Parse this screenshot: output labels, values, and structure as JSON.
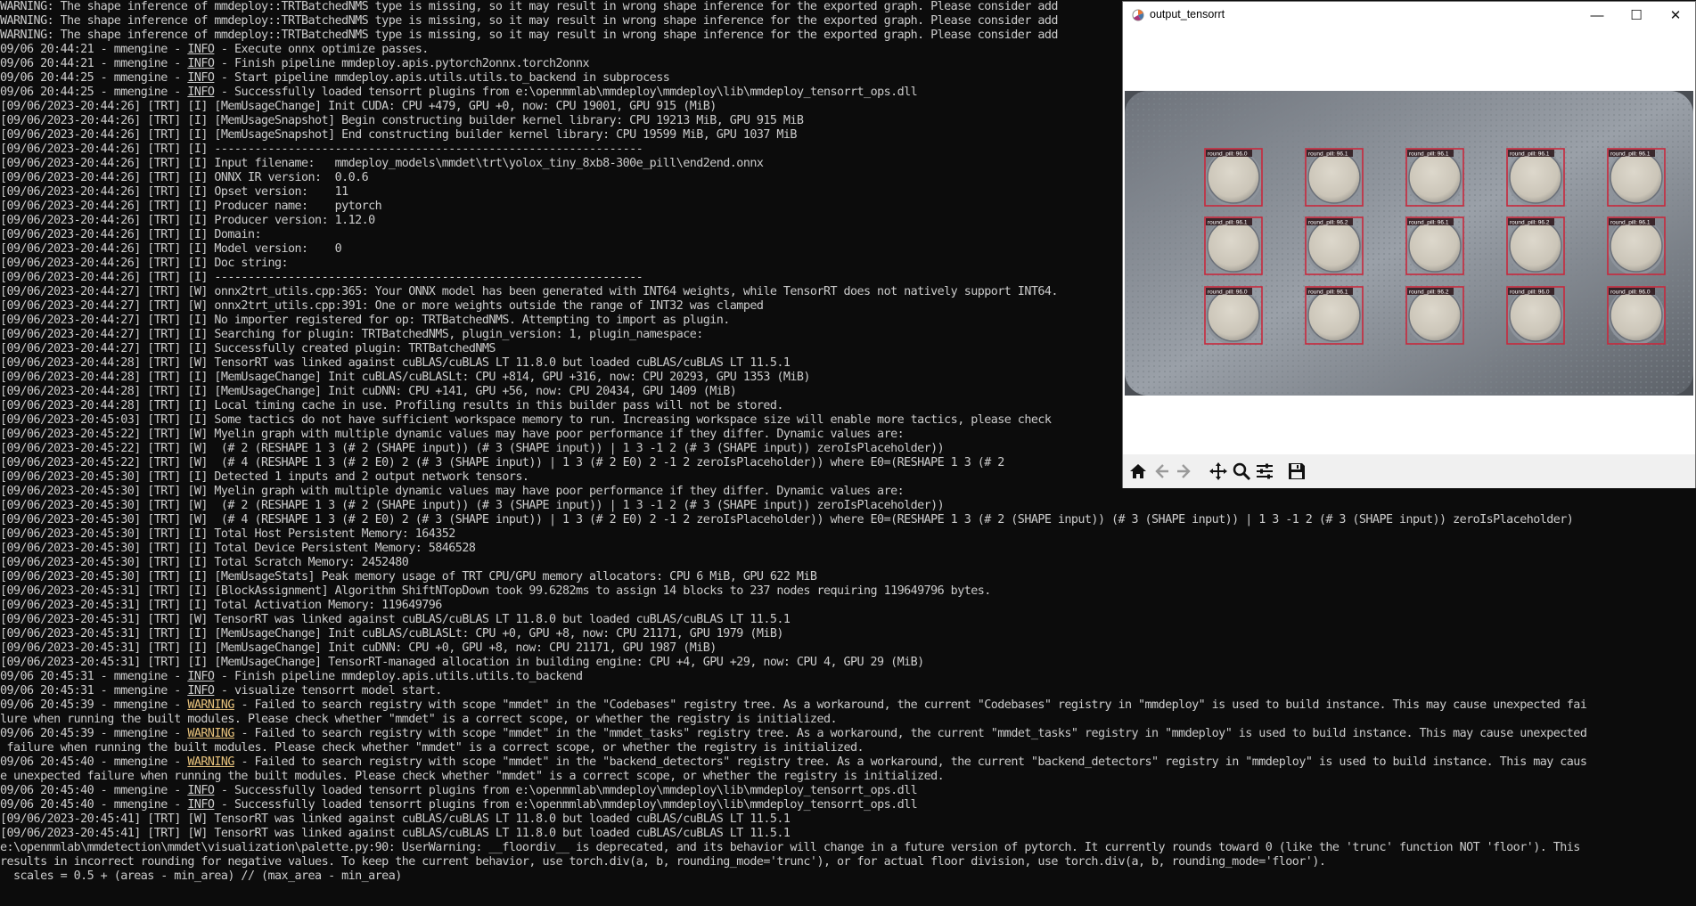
{
  "console": {
    "lines": [
      [
        {
          "t": "WARNING: The shape inference of mmdeploy::TRTBatchedNMS type is missing, so it may result in wrong shape inference for the exported graph. Please consider add"
        }
      ],
      [
        {
          "t": "WARNING: The shape inference of mmdeploy::TRTBatchedNMS type is missing, so it may result in wrong shape inference for the exported graph. Please consider add"
        }
      ],
      [
        {
          "t": "WARNING: The shape inference of mmdeploy::TRTBatchedNMS type is missing, so it may result in wrong shape inference for the exported graph. Please consider add"
        }
      ],
      [
        {
          "t": "09/06 20:44:21 - mmengine - "
        },
        {
          "t": "INFO",
          "c": "info"
        },
        {
          "t": " - Execute onnx optimize passes."
        }
      ],
      [
        {
          "t": "09/06 20:44:21 - mmengine - "
        },
        {
          "t": "INFO",
          "c": "info"
        },
        {
          "t": " - Finish pipeline mmdeploy.apis.pytorch2onnx.torch2onnx"
        }
      ],
      [
        {
          "t": "09/06 20:44:25 - mmengine - "
        },
        {
          "t": "INFO",
          "c": "info"
        },
        {
          "t": " - Start pipeline mmdeploy.apis.utils.utils.to_backend in subprocess"
        }
      ],
      [
        {
          "t": "09/06 20:44:25 - mmengine - "
        },
        {
          "t": "INFO",
          "c": "info"
        },
        {
          "t": " - Successfully loaded tensorrt plugins from e:\\openmmlab\\mmdeploy\\mmdeploy\\lib\\mmdeploy_tensorrt_ops.dll"
        }
      ],
      [
        {
          "t": "[09/06/2023-20:44:26] [TRT] [I] [MemUsageChange] Init CUDA: CPU +479, GPU +0, now: CPU 19001, GPU 915 (MiB)"
        }
      ],
      [
        {
          "t": "[09/06/2023-20:44:26] [TRT] [I] [MemUsageSnapshot] Begin constructing builder kernel library: CPU 19213 MiB, GPU 915 MiB"
        }
      ],
      [
        {
          "t": "[09/06/2023-20:44:26] [TRT] [I] [MemUsageSnapshot] End constructing builder kernel library: CPU 19599 MiB, GPU 1037 MiB"
        }
      ],
      [
        {
          "t": "[09/06/2023-20:44:26] [TRT] [I] ----------------------------------------------------------------"
        }
      ],
      [
        {
          "t": "[09/06/2023-20:44:26] [TRT] [I] Input filename:   mmdeploy_models\\mmdet\\trt\\yolox_tiny_8xb8-300e_pill\\end2end.onnx"
        }
      ],
      [
        {
          "t": "[09/06/2023-20:44:26] [TRT] [I] ONNX IR version:  0.0.6"
        }
      ],
      [
        {
          "t": "[09/06/2023-20:44:26] [TRT] [I] Opset version:    11"
        }
      ],
      [
        {
          "t": "[09/06/2023-20:44:26] [TRT] [I] Producer name:    pytorch"
        }
      ],
      [
        {
          "t": "[09/06/2023-20:44:26] [TRT] [I] Producer version: 1.12.0"
        }
      ],
      [
        {
          "t": "[09/06/2023-20:44:26] [TRT] [I] Domain:"
        }
      ],
      [
        {
          "t": "[09/06/2023-20:44:26] [TRT] [I] Model version:    0"
        }
      ],
      [
        {
          "t": "[09/06/2023-20:44:26] [TRT] [I] Doc string:"
        }
      ],
      [
        {
          "t": "[09/06/2023-20:44:26] [TRT] [I] ----------------------------------------------------------------"
        }
      ],
      [
        {
          "t": "[09/06/2023-20:44:27] [TRT] [W] onnx2trt_utils.cpp:365: Your ONNX model has been generated with INT64 weights, while TensorRT does not natively support INT64."
        }
      ],
      [
        {
          "t": "[09/06/2023-20:44:27] [TRT] [W] onnx2trt_utils.cpp:391: One or more weights outside the range of INT32 was clamped"
        }
      ],
      [
        {
          "t": "[09/06/2023-20:44:27] [TRT] [I] No importer registered for op: TRTBatchedNMS. Attempting to import as plugin."
        }
      ],
      [
        {
          "t": "[09/06/2023-20:44:27] [TRT] [I] Searching for plugin: TRTBatchedNMS, plugin_version: 1, plugin_namespace:"
        }
      ],
      [
        {
          "t": "[09/06/2023-20:44:27] [TRT] [I] Successfully created plugin: TRTBatchedNMS"
        }
      ],
      [
        {
          "t": "[09/06/2023-20:44:28] [TRT] [W] TensorRT was linked against cuBLAS/cuBLAS LT 11.8.0 but loaded cuBLAS/cuBLAS LT 11.5.1"
        }
      ],
      [
        {
          "t": "[09/06/2023-20:44:28] [TRT] [I] [MemUsageChange] Init cuBLAS/cuBLASLt: CPU +814, GPU +316, now: CPU 20293, GPU 1353 (MiB)"
        }
      ],
      [
        {
          "t": "[09/06/2023-20:44:28] [TRT] [I] [MemUsageChange] Init cuDNN: CPU +141, GPU +56, now: CPU 20434, GPU 1409 (MiB)"
        }
      ],
      [
        {
          "t": "[09/06/2023-20:44:28] [TRT] [I] Local timing cache in use. Profiling results in this builder pass will not be stored."
        }
      ],
      [
        {
          "t": "[09/06/2023-20:45:03] [TRT] [I] Some tactics do not have sufficient workspace memory to run. Increasing workspace size will enable more tactics, please check"
        }
      ],
      [
        {
          "t": "[09/06/2023-20:45:22] [TRT] [W] Myelin graph with multiple dynamic values may have poor performance if they differ. Dynamic values are:"
        }
      ],
      [
        {
          "t": "[09/06/2023-20:45:22] [TRT] [W]  (# 2 (RESHAPE 1 3 (# 2 (SHAPE input)) (# 3 (SHAPE input)) | 1 3 -1 2 (# 3 (SHAPE input)) zeroIsPlaceholder))"
        }
      ],
      [
        {
          "t": "[09/06/2023-20:45:22] [TRT] [W]  (# 4 (RESHAPE 1 3 (# 2 E0) 2 (# 3 (SHAPE input)) | 1 3 (# 2 E0) 2 -1 2 zeroIsPlaceholder)) where E0=(RESHAPE 1 3 (# 2"
        }
      ],
      [
        {
          "t": "[09/06/2023-20:45:30] [TRT] [I] Detected 1 inputs and 2 output network tensors."
        }
      ],
      [
        {
          "t": "[09/06/2023-20:45:30] [TRT] [W] Myelin graph with multiple dynamic values may have poor performance if they differ. Dynamic values are:"
        }
      ],
      [
        {
          "t": "[09/06/2023-20:45:30] [TRT] [W]  (# 2 (RESHAPE 1 3 (# 2 (SHAPE input)) (# 3 (SHAPE input)) | 1 3 -1 2 (# 3 (SHAPE input)) zeroIsPlaceholder))"
        }
      ],
      [
        {
          "t": "[09/06/2023-20:45:30] [TRT] [W]  (# 4 (RESHAPE 1 3 (# 2 E0) 2 (# 3 (SHAPE input)) | 1 3 (# 2 E0) 2 -1 2 zeroIsPlaceholder)) where E0=(RESHAPE 1 3 (# 2 (SHAPE input)) (# 3 (SHAPE input)) | 1 3 -1 2 (# 3 (SHAPE input)) zeroIsPlaceholder)"
        }
      ],
      [
        {
          "t": "[09/06/2023-20:45:30] [TRT] [I] Total Host Persistent Memory: 164352"
        }
      ],
      [
        {
          "t": "[09/06/2023-20:45:30] [TRT] [I] Total Device Persistent Memory: 5846528"
        }
      ],
      [
        {
          "t": "[09/06/2023-20:45:30] [TRT] [I] Total Scratch Memory: 2452480"
        }
      ],
      [
        {
          "t": "[09/06/2023-20:45:30] [TRT] [I] [MemUsageStats] Peak memory usage of TRT CPU/GPU memory allocators: CPU 6 MiB, GPU 622 MiB"
        }
      ],
      [
        {
          "t": "[09/06/2023-20:45:31] [TRT] [I] [BlockAssignment] Algorithm ShiftNTopDown took 99.6282ms to assign 14 blocks to 237 nodes requiring 119649796 bytes."
        }
      ],
      [
        {
          "t": "[09/06/2023-20:45:31] [TRT] [I] Total Activation Memory: 119649796"
        }
      ],
      [
        {
          "t": "[09/06/2023-20:45:31] [TRT] [W] TensorRT was linked against cuBLAS/cuBLAS LT 11.8.0 but loaded cuBLAS/cuBLAS LT 11.5.1"
        }
      ],
      [
        {
          "t": "[09/06/2023-20:45:31] [TRT] [I] [MemUsageChange] Init cuBLAS/cuBLASLt: CPU +0, GPU +8, now: CPU 21171, GPU 1979 (MiB)"
        }
      ],
      [
        {
          "t": "[09/06/2023-20:45:31] [TRT] [I] [MemUsageChange] Init cuDNN: CPU +0, GPU +8, now: CPU 21171, GPU 1987 (MiB)"
        }
      ],
      [
        {
          "t": "[09/06/2023-20:45:31] [TRT] [I] [MemUsageChange] TensorRT-managed allocation in building engine: CPU +4, GPU +29, now: CPU 4, GPU 29 (MiB)"
        }
      ],
      [
        {
          "t": "09/06 20:45:31 - mmengine - "
        },
        {
          "t": "INFO",
          "c": "info"
        },
        {
          "t": " - Finish pipeline mmdeploy.apis.utils.utils.to_backend"
        }
      ],
      [
        {
          "t": "09/06 20:45:31 - mmengine - "
        },
        {
          "t": "INFO",
          "c": "info"
        },
        {
          "t": " - visualize tensorrt model start."
        }
      ],
      [
        {
          "t": "09/06 20:45:39 - mmengine - "
        },
        {
          "t": "WARNING",
          "c": "warn"
        },
        {
          "t": " - Failed to search registry with scope \"mmdet\" in the \"Codebases\" registry tree. As a workaround, the current \"Codebases\" registry in \"mmdeploy\" is used to build instance. This may cause unexpected fai"
        }
      ],
      [
        {
          "t": "lure when running the built modules. Please check whether \"mmdet\" is a correct scope, or whether the registry is initialized."
        }
      ],
      [
        {
          "t": "09/06 20:45:39 - mmengine - "
        },
        {
          "t": "WARNING",
          "c": "warn"
        },
        {
          "t": " - Failed to search registry with scope \"mmdet\" in the \"mmdet_tasks\" registry tree. As a workaround, the current \"mmdet_tasks\" registry in \"mmdeploy\" is used to build instance. This may cause unexpected"
        }
      ],
      [
        {
          "t": " failure when running the built modules. Please check whether \"mmdet\" is a correct scope, or whether the registry is initialized."
        }
      ],
      [
        {
          "t": "09/06 20:45:40 - mmengine - "
        },
        {
          "t": "WARNING",
          "c": "warn"
        },
        {
          "t": " - Failed to search registry with scope \"mmdet\" in the \"backend_detectors\" registry tree. As a workaround, the current \"backend_detectors\" registry in \"mmdeploy\" is used to build instance. This may caus"
        }
      ],
      [
        {
          "t": "e unexpected failure when running the built modules. Please check whether \"mmdet\" is a correct scope, or whether the registry is initialized."
        }
      ],
      [
        {
          "t": "09/06 20:45:40 - mmengine - "
        },
        {
          "t": "INFO",
          "c": "info"
        },
        {
          "t": " - Successfully loaded tensorrt plugins from e:\\openmmlab\\mmdeploy\\mmdeploy\\lib\\mmdeploy_tensorrt_ops.dll"
        }
      ],
      [
        {
          "t": "09/06 20:45:40 - mmengine - "
        },
        {
          "t": "INFO",
          "c": "info"
        },
        {
          "t": " - Successfully loaded tensorrt plugins from e:\\openmmlab\\mmdeploy\\mmdeploy\\lib\\mmdeploy_tensorrt_ops.dll"
        }
      ],
      [
        {
          "t": "[09/06/2023-20:45:41] [TRT] [W] TensorRT was linked against cuBLAS/cuBLAS LT 11.8.0 but loaded cuBLAS/cuBLAS LT 11.5.1"
        }
      ],
      [
        {
          "t": "[09/06/2023-20:45:41] [TRT] [W] TensorRT was linked against cuBLAS/cuBLAS LT 11.8.0 but loaded cuBLAS/cuBLAS LT 11.5.1"
        }
      ],
      [
        {
          "t": "e:\\openmmlab\\mmdetection\\mmdet\\visualization\\palette.py:90: UserWarning: __floordiv__ is deprecated, and its behavior will change in a future version of pytorch. It currently rounds toward 0 (like the 'trunc' function NOT 'floor'). This"
        }
      ],
      [
        {
          "t": "results in incorrect rounding for negative values. To keep the current behavior, use torch.div(a, b, rounding_mode='trunc'), or for actual floor division, use torch.div(a, b, rounding_mode='floor')."
        }
      ],
      [
        {
          "t": "  scales = 0.5 + (areas - min_area) // (max_area - min_area)"
        }
      ]
    ]
  },
  "window": {
    "title": "output_tensorrt",
    "minimize_glyph": "—",
    "maximize_glyph": "☐",
    "close_glyph": "✕"
  },
  "detections": {
    "rows": [
      [
        "round_pill: 96.0",
        "round_pill: 96.1",
        "round_pill: 96.1",
        "round_pill: 96.1",
        "round_pill: 96.1"
      ],
      [
        "round_pill: 96.1",
        "round_pill: 96.2",
        "round_pill: 96.1",
        "round_pill: 96.2",
        "round_pill: 96.1"
      ],
      [
        "round_pill: 96.0",
        "round_pill: 96.1",
        "round_pill: 96.2",
        "round_pill: 96.0",
        "round_pill: 96.0"
      ]
    ],
    "box_color": "#c8283c",
    "label_bg": "#2a1418",
    "label_color": "#ffffff"
  },
  "toolbar": {
    "icons": [
      "home-icon",
      "back-arrow-icon",
      "forward-arrow-icon",
      "pan-move-icon",
      "zoom-magnifier-icon",
      "configure-subplots-icon",
      "save-floppy-icon"
    ]
  },
  "colors": {
    "console_bg": "#0c0c0c",
    "console_fg": "#cccccc",
    "warning_fg": "#e5c07b"
  }
}
